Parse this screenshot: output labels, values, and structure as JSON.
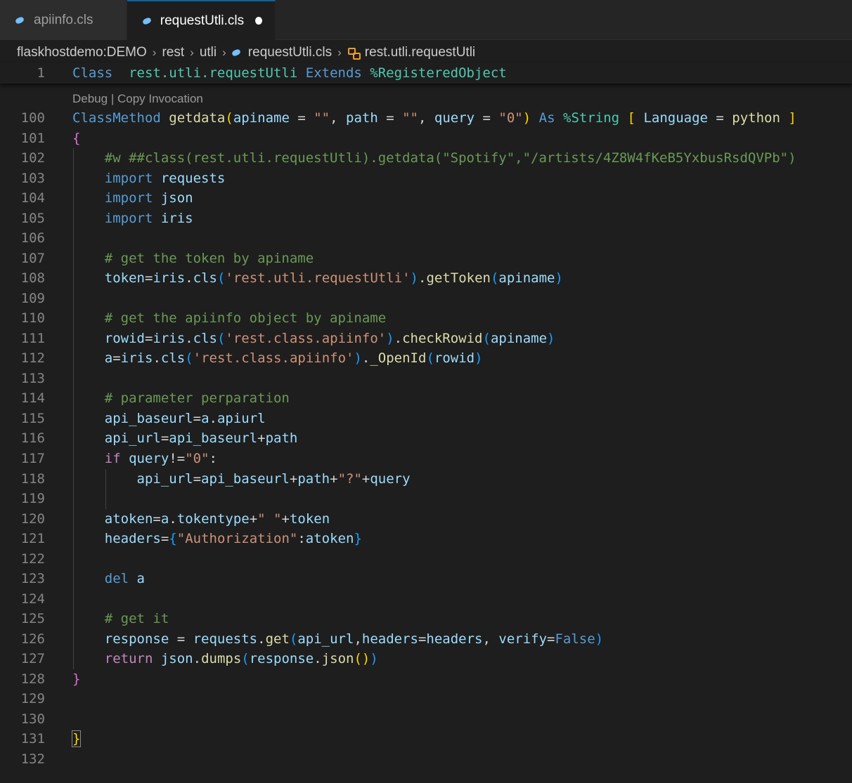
{
  "tabs": [
    {
      "label": "apiinfo.cls",
      "active": false
    },
    {
      "label": "requestUtli.cls",
      "active": true,
      "dirty": true
    }
  ],
  "breadcrumb": {
    "items": [
      "flaskhostdemo:DEMO",
      "rest",
      "utli",
      "requestUtli.cls",
      "rest.utli.requestUtli"
    ]
  },
  "codelens": "Debug | Copy Invocation",
  "lines": [
    {
      "n": "1",
      "tokens": [
        [
          "kw",
          "Class"
        ],
        [
          "",
          "  "
        ],
        [
          "ty",
          "rest.utli.requestUtli"
        ],
        [
          "",
          ""
        ],
        [
          "kw",
          " Extends"
        ],
        [
          "",
          ""
        ],
        [
          "ty",
          " %RegisteredObject"
        ]
      ]
    },
    {
      "n": "100",
      "tokens": [
        [
          "kw",
          "ClassMethod"
        ],
        [
          "",
          " "
        ],
        [
          "fn",
          "getdata"
        ],
        [
          "br1",
          "("
        ],
        [
          "prm",
          "apiname"
        ],
        [
          "",
          " = "
        ],
        [
          "str",
          "\"\""
        ],
        [
          "",
          ", "
        ],
        [
          "prm",
          "path"
        ],
        [
          "",
          " = "
        ],
        [
          "str",
          "\"\""
        ],
        [
          "",
          ", "
        ],
        [
          "prm",
          "query"
        ],
        [
          "",
          " = "
        ],
        [
          "str",
          "\"0\""
        ],
        [
          "br1",
          ")"
        ],
        [
          "",
          " "
        ],
        [
          "kw",
          "As"
        ],
        [
          "",
          " "
        ],
        [
          "ty",
          "%String"
        ],
        [
          "",
          " "
        ],
        [
          "br1",
          "["
        ],
        [
          "",
          " "
        ],
        [
          "prm",
          "Language"
        ],
        [
          "",
          " = "
        ],
        [
          "fn",
          "python"
        ],
        [
          "",
          " "
        ],
        [
          "br1",
          "]"
        ]
      ]
    },
    {
      "n": "101",
      "tokens": [
        [
          "br2",
          "{"
        ]
      ]
    },
    {
      "n": "102",
      "tokens": [
        [
          "",
          "    "
        ],
        [
          "cm",
          "#w ##class(rest.utli.requestUtli).getdata(\"Spotify\",\"/artists/4Z8W4fKeB5YxbusRsdQVPb\")"
        ]
      ]
    },
    {
      "n": "103",
      "tokens": [
        [
          "",
          "    "
        ],
        [
          "kw",
          "import"
        ],
        [
          "",
          " "
        ],
        [
          "prm",
          "requests"
        ]
      ]
    },
    {
      "n": "104",
      "tokens": [
        [
          "",
          "    "
        ],
        [
          "kw",
          "import"
        ],
        [
          "",
          " "
        ],
        [
          "prm",
          "json"
        ]
      ]
    },
    {
      "n": "105",
      "tokens": [
        [
          "",
          "    "
        ],
        [
          "kw",
          "import"
        ],
        [
          "",
          " "
        ],
        [
          "prm",
          "iris"
        ]
      ]
    },
    {
      "n": "106",
      "tokens": []
    },
    {
      "n": "107",
      "tokens": [
        [
          "",
          "    "
        ],
        [
          "cm",
          "# get the token by apiname"
        ]
      ]
    },
    {
      "n": "108",
      "tokens": [
        [
          "",
          "    "
        ],
        [
          "prm",
          "token"
        ],
        [
          "",
          "="
        ],
        [
          "prm",
          "iris"
        ],
        [
          "",
          "."
        ],
        [
          "prm",
          "cls"
        ],
        [
          "br3",
          "("
        ],
        [
          "str",
          "'rest.utli.requestUtli'"
        ],
        [
          "br3",
          ")"
        ],
        [
          "",
          "."
        ],
        [
          "fn",
          "getToken"
        ],
        [
          "br3",
          "("
        ],
        [
          "prm",
          "apiname"
        ],
        [
          "br3",
          ")"
        ]
      ]
    },
    {
      "n": "109",
      "tokens": []
    },
    {
      "n": "110",
      "tokens": [
        [
          "",
          "    "
        ],
        [
          "cm",
          "# get the apiinfo object by apiname"
        ]
      ]
    },
    {
      "n": "111",
      "tokens": [
        [
          "",
          "    "
        ],
        [
          "prm",
          "rowid"
        ],
        [
          "",
          "="
        ],
        [
          "prm",
          "iris"
        ],
        [
          "",
          "."
        ],
        [
          "prm",
          "cls"
        ],
        [
          "br3",
          "("
        ],
        [
          "str",
          "'rest.class.apiinfo'"
        ],
        [
          "br3",
          ")"
        ],
        [
          "",
          "."
        ],
        [
          "fn",
          "checkRowid"
        ],
        [
          "br3",
          "("
        ],
        [
          "prm",
          "apiname"
        ],
        [
          "br3",
          ")"
        ]
      ]
    },
    {
      "n": "112",
      "tokens": [
        [
          "",
          "    "
        ],
        [
          "prm",
          "a"
        ],
        [
          "",
          "="
        ],
        [
          "prm",
          "iris"
        ],
        [
          "",
          "."
        ],
        [
          "prm",
          "cls"
        ],
        [
          "br3",
          "("
        ],
        [
          "str",
          "'rest.class.apiinfo'"
        ],
        [
          "br3",
          ")"
        ],
        [
          "",
          "."
        ],
        [
          "fn",
          "_OpenId"
        ],
        [
          "br3",
          "("
        ],
        [
          "prm",
          "rowid"
        ],
        [
          "br3",
          ")"
        ]
      ]
    },
    {
      "n": "113",
      "tokens": []
    },
    {
      "n": "114",
      "tokens": [
        [
          "",
          "    "
        ],
        [
          "cm",
          "# parameter perparation"
        ]
      ]
    },
    {
      "n": "115",
      "tokens": [
        [
          "",
          "    "
        ],
        [
          "prm",
          "api_baseurl"
        ],
        [
          "",
          "="
        ],
        [
          "prm",
          "a"
        ],
        [
          "",
          "."
        ],
        [
          "prm",
          "apiurl"
        ]
      ]
    },
    {
      "n": "116",
      "tokens": [
        [
          "",
          "    "
        ],
        [
          "prm",
          "api_url"
        ],
        [
          "",
          "="
        ],
        [
          "prm",
          "api_baseurl"
        ],
        [
          "",
          "+"
        ],
        [
          "prm",
          "path"
        ]
      ]
    },
    {
      "n": "117",
      "tokens": [
        [
          "",
          "    "
        ],
        [
          "ctrl",
          "if"
        ],
        [
          "",
          " "
        ],
        [
          "prm",
          "query"
        ],
        [
          "",
          "!="
        ],
        [
          "str",
          "\"0\""
        ],
        [
          "",
          ":"
        ]
      ]
    },
    {
      "n": "118",
      "tokens": [
        [
          "",
          "        "
        ],
        [
          "prm",
          "api_url"
        ],
        [
          "",
          "="
        ],
        [
          "prm",
          "api_baseurl"
        ],
        [
          "",
          "+"
        ],
        [
          "prm",
          "path"
        ],
        [
          "",
          "+"
        ],
        [
          "str",
          "\"?\""
        ],
        [
          "",
          "+"
        ],
        [
          "prm",
          "query"
        ]
      ]
    },
    {
      "n": "119",
      "tokens": []
    },
    {
      "n": "120",
      "tokens": [
        [
          "",
          "    "
        ],
        [
          "prm",
          "atoken"
        ],
        [
          "",
          "="
        ],
        [
          "prm",
          "a"
        ],
        [
          "",
          "."
        ],
        [
          "prm",
          "tokentype"
        ],
        [
          "",
          "+"
        ],
        [
          "str",
          "\" \""
        ],
        [
          "",
          "+"
        ],
        [
          "prm",
          "token"
        ]
      ]
    },
    {
      "n": "121",
      "tokens": [
        [
          "",
          "    "
        ],
        [
          "prm",
          "headers"
        ],
        [
          "",
          "="
        ],
        [
          "br3",
          "{"
        ],
        [
          "str",
          "\"Authorization\""
        ],
        [
          "",
          ":"
        ],
        [
          "prm",
          "atoken"
        ],
        [
          "br3",
          "}"
        ]
      ]
    },
    {
      "n": "122",
      "tokens": []
    },
    {
      "n": "123",
      "tokens": [
        [
          "",
          "    "
        ],
        [
          "kw",
          "del"
        ],
        [
          "",
          " "
        ],
        [
          "prm",
          "a"
        ]
      ]
    },
    {
      "n": "124",
      "tokens": []
    },
    {
      "n": "125",
      "tokens": [
        [
          "",
          "    "
        ],
        [
          "cm",
          "# get it"
        ]
      ]
    },
    {
      "n": "126",
      "tokens": [
        [
          "",
          "    "
        ],
        [
          "prm",
          "response"
        ],
        [
          "",
          " = "
        ],
        [
          "prm",
          "requests"
        ],
        [
          "",
          "."
        ],
        [
          "fn",
          "get"
        ],
        [
          "br3",
          "("
        ],
        [
          "prm",
          "api_url"
        ],
        [
          "",
          ","
        ],
        [
          "prm",
          "headers"
        ],
        [
          "",
          "="
        ],
        [
          "prm",
          "headers"
        ],
        [
          "",
          ", "
        ],
        [
          "prm",
          "verify"
        ],
        [
          "",
          "="
        ],
        [
          "bool",
          "False"
        ],
        [
          "br3",
          ")"
        ]
      ]
    },
    {
      "n": "127",
      "tokens": [
        [
          "",
          "    "
        ],
        [
          "ctrl",
          "return"
        ],
        [
          "",
          " "
        ],
        [
          "prm",
          "json"
        ],
        [
          "",
          "."
        ],
        [
          "fn",
          "dumps"
        ],
        [
          "br3",
          "("
        ],
        [
          "prm",
          "response"
        ],
        [
          "",
          "."
        ],
        [
          "fn",
          "json"
        ],
        [
          "br1",
          "()"
        ],
        [
          "br3",
          ")"
        ]
      ]
    },
    {
      "n": "128",
      "tokens": [
        [
          "br2",
          "}"
        ]
      ]
    },
    {
      "n": "129",
      "tokens": []
    },
    {
      "n": "130",
      "tokens": []
    },
    {
      "n": "131",
      "tokens": [
        [
          "br1",
          "}"
        ]
      ]
    },
    {
      "n": "132",
      "tokens": []
    }
  ]
}
